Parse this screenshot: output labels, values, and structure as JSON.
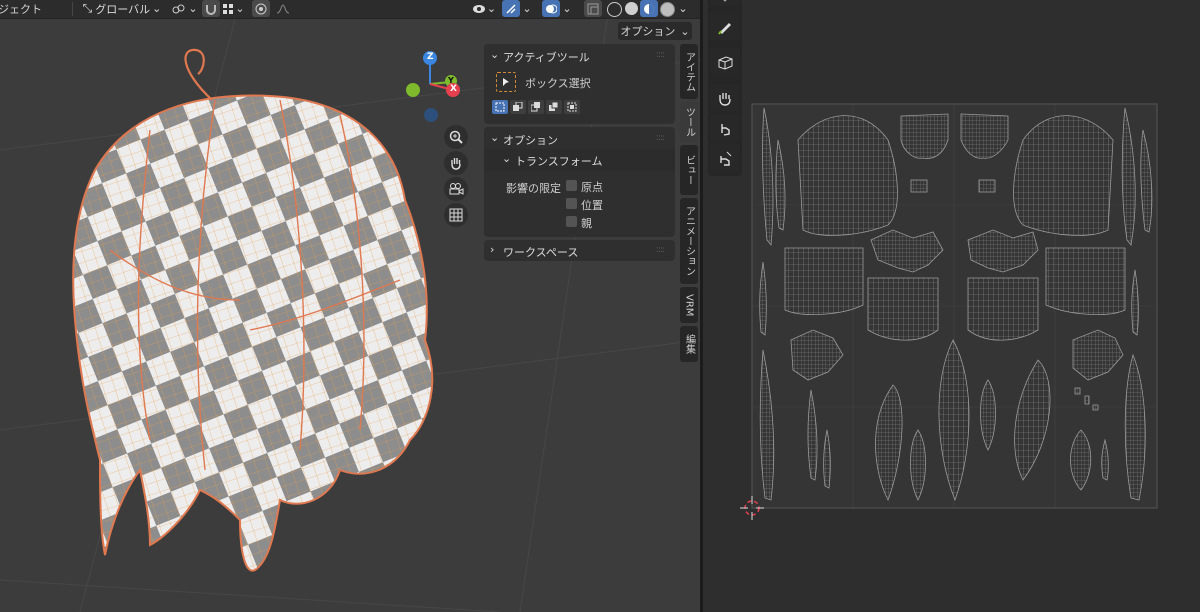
{
  "header": {
    "mode_partial": "ジェクト",
    "transform_orientation": "グローバル",
    "chevron": "⌄"
  },
  "options_button": "オプション",
  "sidebar": {
    "active_tool": {
      "title": "アクティブツール",
      "tool_name": "ボックス選択"
    },
    "options": {
      "title": "オプション",
      "transform_title": "トランスフォーム",
      "affect_only_label": "影響の限定",
      "checkboxes": [
        {
          "label": "原点",
          "checked": false
        },
        {
          "label": "位置",
          "checked": false
        },
        {
          "label": "親",
          "checked": false
        }
      ]
    },
    "workspace": {
      "title": "ワークスペース"
    }
  },
  "tabs": [
    {
      "label": "アイテム"
    },
    {
      "label": "ツール"
    },
    {
      "label": "ビュー"
    },
    {
      "label": "アニメーション"
    },
    {
      "label": "VRM"
    },
    {
      "label": "編集"
    }
  ],
  "gizmo": {
    "z": "Z",
    "y": "Y",
    "x": "X"
  },
  "colors": {
    "accent": "#4772b3",
    "viewport_bg": "#3c3c3c",
    "panel_bg": "#2f2f2f",
    "selection_outline": "#e8a050",
    "axis_x": "#e6404f",
    "axis_y": "#7fb92c",
    "axis_z": "#3b86e0"
  },
  "icons": {
    "view_object_types": "eye-icon",
    "gizmo_toggle": "gizmo-icon",
    "overlays": "overlay-icon",
    "xray": "xray-icon",
    "zoom": "zoom-icon",
    "pan": "hand-icon",
    "camera": "camera-icon",
    "ortho": "grid-icon"
  }
}
